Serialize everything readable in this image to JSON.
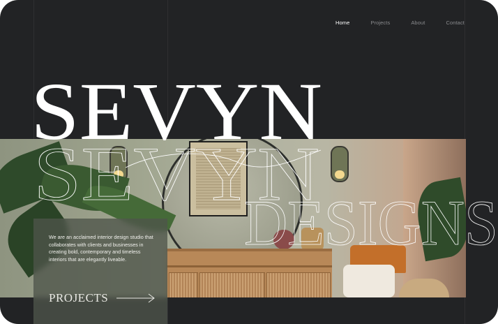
{
  "nav": {
    "items": [
      {
        "label": "Home",
        "active": true
      },
      {
        "label": "Projects",
        "active": false
      },
      {
        "label": "About",
        "active": false
      },
      {
        "label": "Contact",
        "active": false
      }
    ]
  },
  "hero": {
    "title": "SEVYN",
    "subtitle": "DESIGNS",
    "description": "We are an acclaimed interior design studio that collaborates with clients and businesses in creating bold, contemporary and timeless interiors that are elegantly liveable.",
    "cta_label": "PROJECTS",
    "cta_icon": "arrow-right-icon"
  },
  "colors": {
    "background": "#222325",
    "text": "#ffffff",
    "nav_inactive": "#8a8b8e",
    "card": "#4e544a"
  }
}
